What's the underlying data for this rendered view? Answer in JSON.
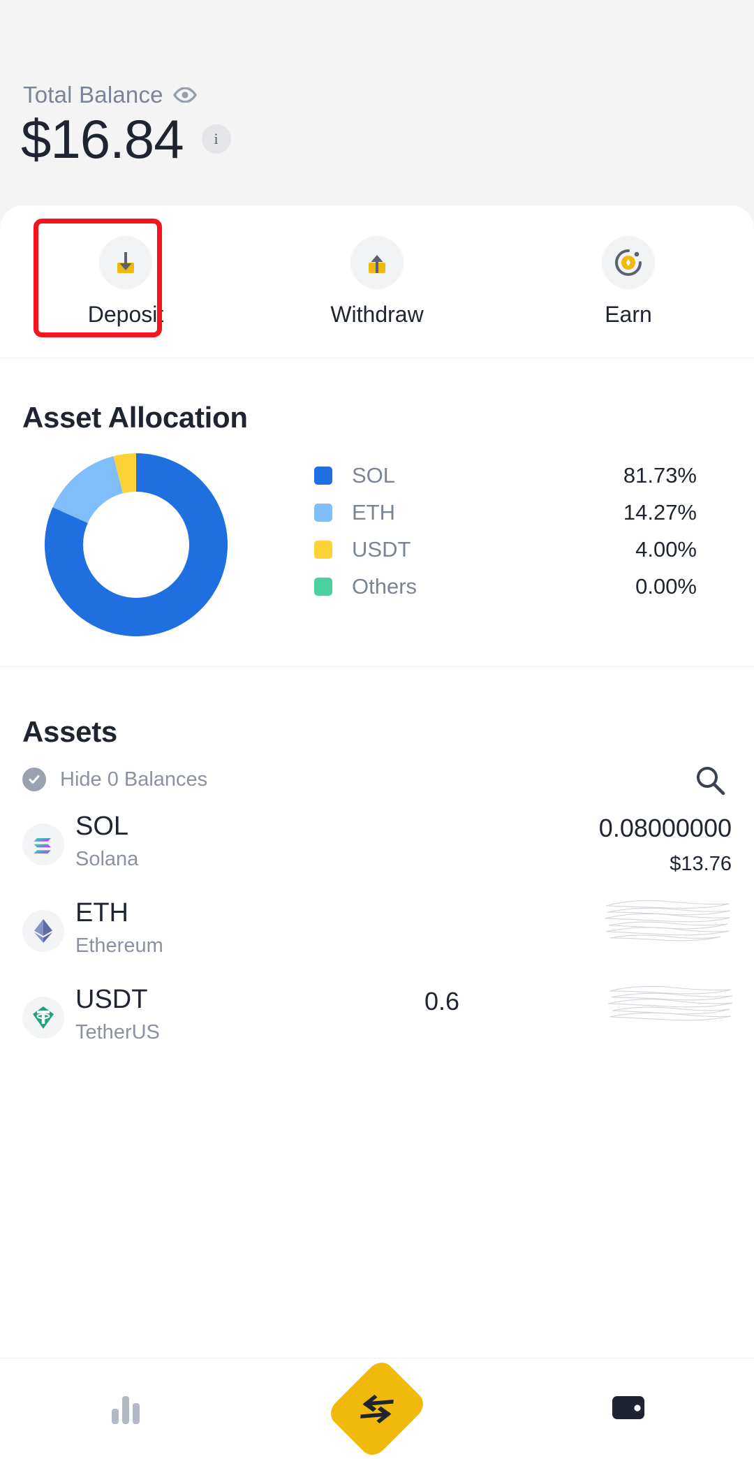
{
  "header": {
    "balance_label": "Total Balance",
    "eye_icon": "eye-icon",
    "balance_amount": "$16.84",
    "info_icon": "i"
  },
  "quick_actions": [
    {
      "label": "Deposit",
      "icon": "deposit-icon",
      "highlighted": true
    },
    {
      "label": "Withdraw",
      "icon": "withdraw-icon",
      "highlighted": false
    },
    {
      "label": "Earn",
      "icon": "earn-icon",
      "highlighted": false
    }
  ],
  "allocation": {
    "title": "Asset Allocation"
  },
  "chart_data": {
    "type": "pie",
    "title": "Asset Allocation",
    "legend_position": "right",
    "categories": [
      "SOL",
      "ETH",
      "USDT",
      "Others"
    ],
    "values": [
      81.73,
      14.27,
      4.0,
      0.0
    ],
    "labels": [
      "81.73%",
      "14.27%",
      "4.00%",
      "0.00%"
    ],
    "colors": [
      "#1f6fe0",
      "#80bdfb",
      "#fbd336",
      "#4bd0a0"
    ],
    "donut": true,
    "inner_radius_ratio": 0.58,
    "start_angle": 0,
    "units": "percent"
  },
  "assets": {
    "title": "Assets",
    "hide_zero_label": "Hide 0 Balances",
    "hide_zero_checked": true,
    "check_icon": "check-circle-icon",
    "search_icon": "search-icon",
    "rows": [
      {
        "symbol": "SOL",
        "name": "Solana",
        "icon": "solana-icon",
        "amount": "0.08000000",
        "usd": "$13.76",
        "redacted": false
      },
      {
        "symbol": "ETH",
        "name": "Ethereum",
        "icon": "ethereum-icon",
        "amount": "",
        "usd": "",
        "redacted": true
      },
      {
        "symbol": "USDT",
        "name": "TetherUS",
        "icon": "tether-icon",
        "amount": "0.6",
        "usd": "",
        "redacted": true
      }
    ]
  },
  "bottom_nav": [
    {
      "icon": "bar-chart-icon",
      "active": false
    },
    {
      "icon": "swap-icon",
      "active": true
    },
    {
      "icon": "wallet-icon",
      "active": false
    }
  ],
  "colors": {
    "accent_yellow": "#f0b90b",
    "highlight_red": "#f5141e",
    "sol_blue": "#1f6fe0",
    "eth_blue": "#80bdfb",
    "usdt_yellow": "#fbd336",
    "others_green": "#4bd0a0",
    "text_dark": "#1e2430",
    "text_muted": "#8a92a1"
  }
}
